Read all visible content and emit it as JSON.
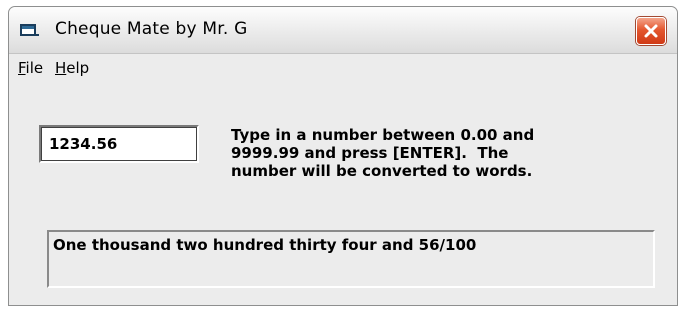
{
  "window": {
    "title": "Cheque Mate by Mr. G",
    "icon": "app-window-icon",
    "close_icon": "close-icon"
  },
  "menu": {
    "file": {
      "accel": "F",
      "rest": "ile"
    },
    "help": {
      "accel": "H",
      "rest": "elp"
    }
  },
  "input": {
    "value": "1234.56"
  },
  "instructions": {
    "line1": "Type in a number between 0.00 and",
    "line2": "9999.99 and press [ENTER].  The",
    "line3": "number will be converted to words."
  },
  "output": {
    "text": "One thousand two hundred thirty four and 56/100"
  },
  "colors": {
    "close_button": "#e4572f",
    "window_face": "#ececec"
  }
}
